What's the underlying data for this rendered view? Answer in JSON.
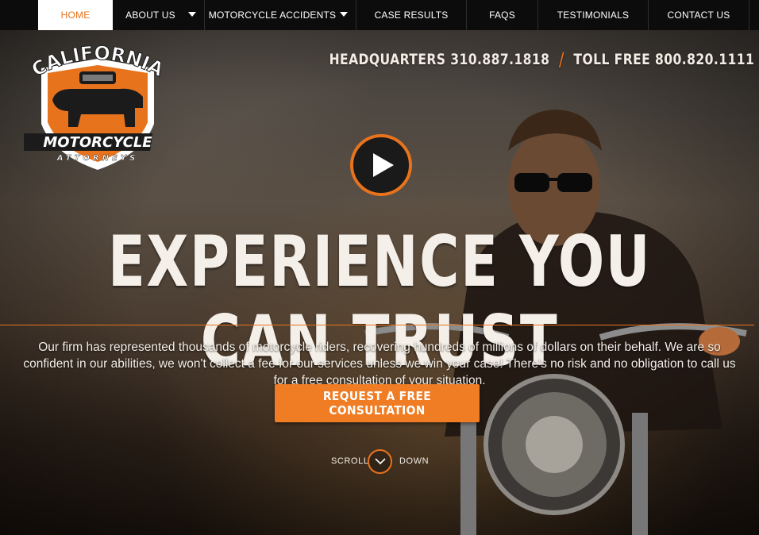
{
  "nav": {
    "items": [
      {
        "label": "HOME",
        "active": true,
        "dropdown": false
      },
      {
        "label": "ABOUT US",
        "active": false,
        "dropdown": true
      },
      {
        "label": "MOTORCYCLE ACCIDENTS",
        "active": false,
        "dropdown": true
      },
      {
        "label": "CASE RESULTS",
        "active": false,
        "dropdown": false
      },
      {
        "label": "FAQS",
        "active": false,
        "dropdown": false
      },
      {
        "label": "TESTIMONIALS",
        "active": false,
        "dropdown": false
      },
      {
        "label": "CONTACT US",
        "active": false,
        "dropdown": false
      }
    ]
  },
  "logo": {
    "line1": "CALIFORNIA",
    "line2": "MOTORCYCLE",
    "line3": "ATTORNEYS",
    "icon": "bear-shield-logo"
  },
  "phones": {
    "headquarters": "HEADQUARTERS 310.887.1818",
    "separator": "/",
    "toll_free": "TOLL FREE 800.820.1111"
  },
  "video": {
    "icon": "play-icon"
  },
  "hero": {
    "title": "EXPERIENCE YOU CAN TRUST",
    "body": "Our firm has represented thousands of motorcycle riders, recovering hundreds of millions of dollars on their behalf. We are so confident in our abilities, we won't collect a fee for our services unless we win your case! There's no risk and no obligation to call us for a free consultation of your situation.",
    "cta": "REQUEST A FREE CONSULTATION"
  },
  "scroll": {
    "left": "SCROLL",
    "right": "DOWN",
    "icon": "chevron-down-icon"
  },
  "colors": {
    "accent": "#e8731d",
    "cta": "#f07c23",
    "nav_bg": "#0c0c0c",
    "text": "#f4efe8"
  }
}
